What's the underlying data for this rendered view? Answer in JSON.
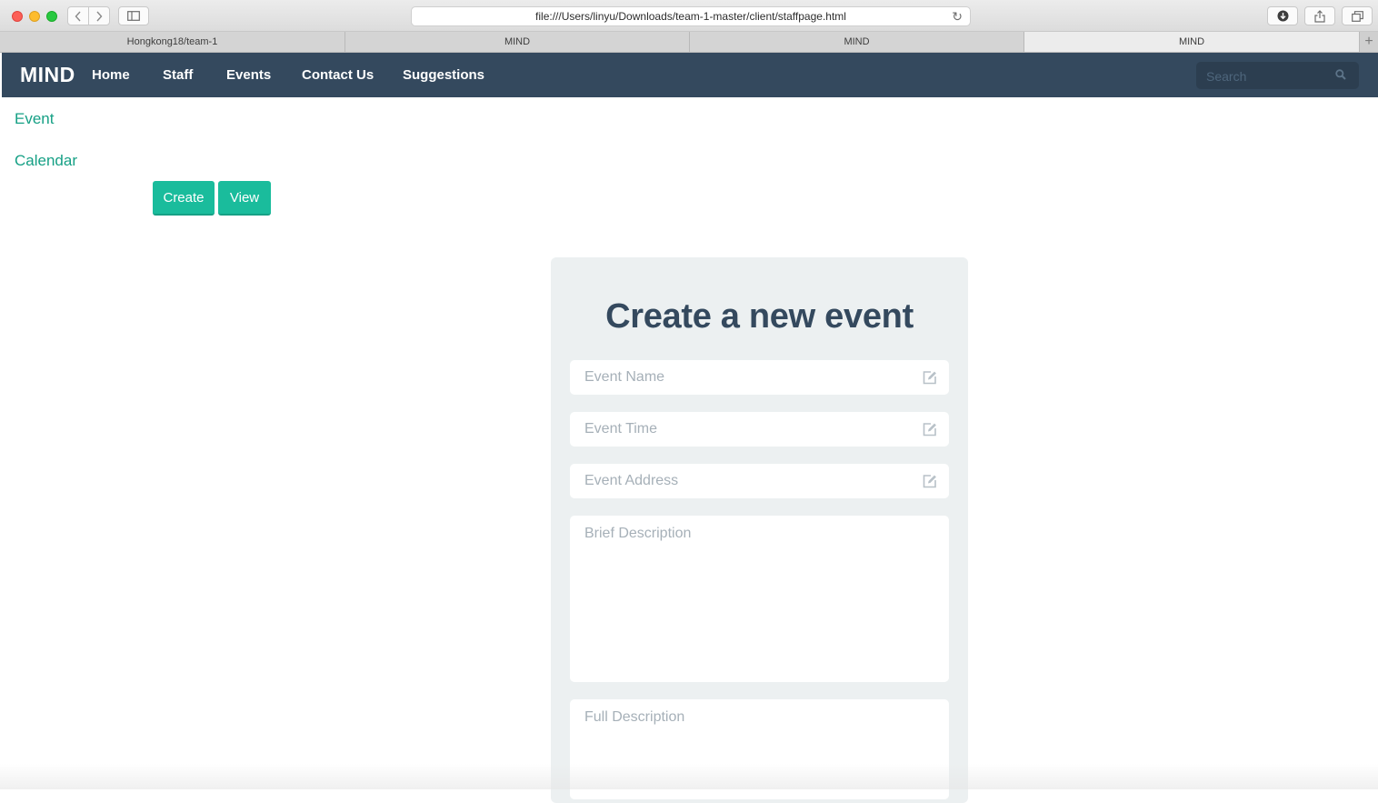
{
  "browser": {
    "url": "file:///Users/linyu/Downloads/team-1-master/client/staffpage.html",
    "tabs": [
      {
        "label": "Hongkong18/team-1",
        "active": false
      },
      {
        "label": "MIND",
        "active": false
      },
      {
        "label": "MIND",
        "active": false
      },
      {
        "label": "MIND",
        "active": true
      }
    ]
  },
  "navbar": {
    "brand": "MIND",
    "links": [
      "Home",
      "Staff",
      "Events",
      "Contact Us",
      "Suggestions"
    ],
    "search_placeholder": "Search"
  },
  "sidebar": {
    "links": [
      "Event",
      "Calendar"
    ]
  },
  "actions": {
    "create_label": "Create",
    "view_label": "View"
  },
  "form": {
    "title": "Create a new event",
    "fields": {
      "event_name": "Event Name",
      "event_time": "Event Time",
      "event_address": "Event Address",
      "brief_description": "Brief Description",
      "full_description": "Full Description"
    }
  },
  "colors": {
    "navbar": "#34495e",
    "accent": "#1abc9c",
    "link": "#16a085",
    "card": "#ecf0f1"
  }
}
